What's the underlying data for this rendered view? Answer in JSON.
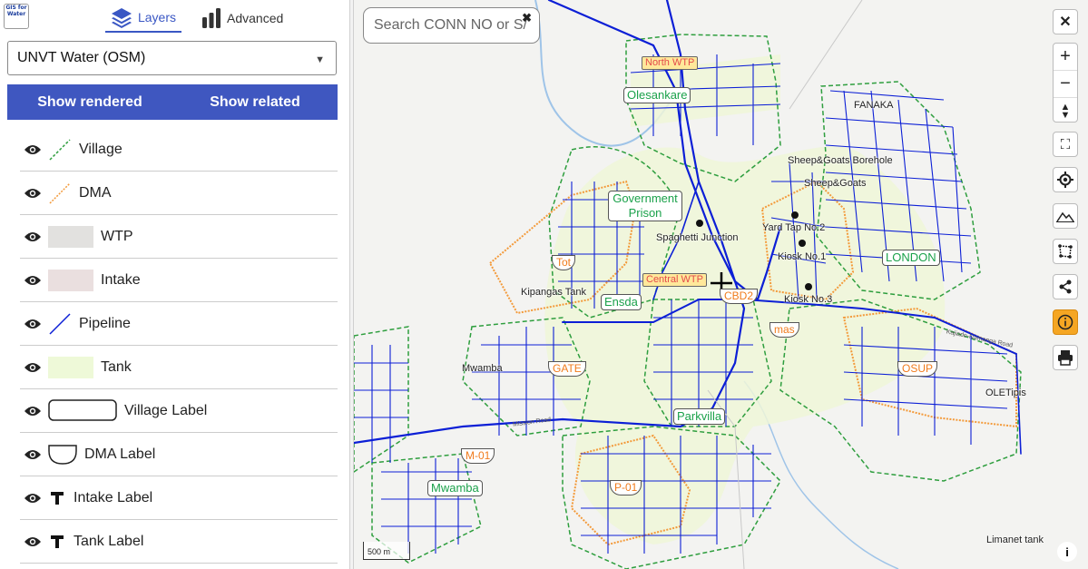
{
  "logo": {
    "text": "GIS for Water"
  },
  "tabs": {
    "layers": "Layers",
    "advanced": "Advanced"
  },
  "style_select": {
    "value": "UNVT Water (OSM)"
  },
  "buttons": {
    "show_rendered": "Show rendered",
    "show_related": "Show related"
  },
  "legend": {
    "village": "Village",
    "dma": "DMA",
    "wtp": "WTP",
    "intake": "Intake",
    "pipeline": "Pipeline",
    "tank": "Tank",
    "village_label": "Village Label",
    "dma_label": "DMA Label",
    "intake_label": "Intake Label",
    "tank_label": "Tank Label"
  },
  "search": {
    "placeholder": "Search CONN NO or S/"
  },
  "map": {
    "scale": "500 m",
    "village_labels": [
      "Olesankare",
      "Government Prison",
      "LONDON",
      "Ensda",
      "Parkvilla",
      "Mwamba"
    ],
    "dma_labels": [
      "Tot",
      "CBD2",
      "mas",
      "GATE",
      "OSUP",
      "M-01",
      "P-01"
    ],
    "wtp_labels": [
      "North WTP",
      "Central WTP"
    ],
    "place_labels": [
      "FANAKA",
      "Sheep&Goats Borehole",
      "Sheep&Goats",
      "Spaghetti Junction",
      "Yard Tap No.2",
      "Kiosk No.1",
      "Kiosk No.3",
      "Kipangas Tank",
      "Mwamba",
      "OLETipis",
      "Limanet tank"
    ],
    "road_labels": [
      "Kajiado-Namanga Road",
      "Mission Road"
    ]
  },
  "colors": {
    "accent": "#3f57c0",
    "pipeline": "#0c1fd6",
    "village": "#2e9e3e",
    "dma": "#f39a3a",
    "tank": "#eef6d8"
  }
}
